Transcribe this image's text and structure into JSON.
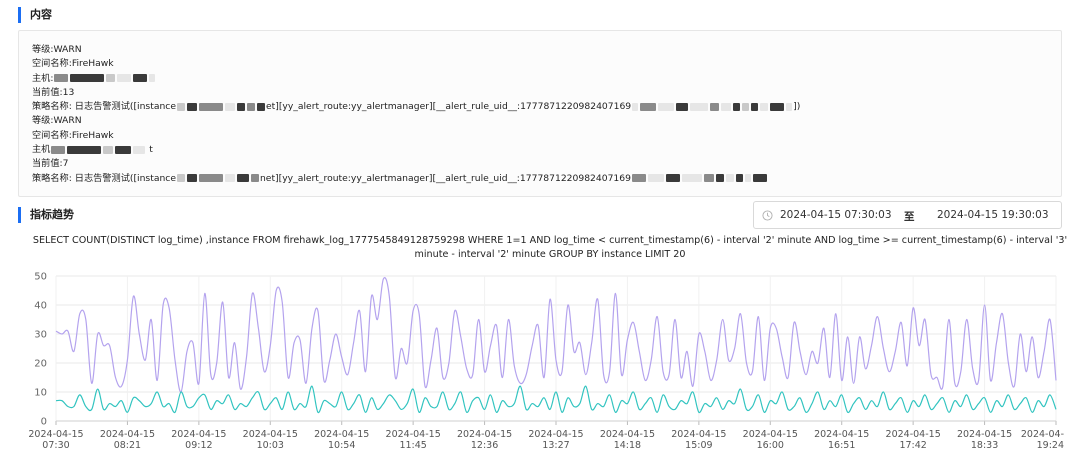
{
  "sections": {
    "content_title": "内容",
    "trend_title": "指标趋势"
  },
  "alerts": [
    {
      "level": "等级:WARN",
      "space": "空间名称:FireHawk",
      "host_prefix": "主机:",
      "value": "当前值:13",
      "policy_prefix": "策略名称: 日志告警测试([instance",
      "policy_mid": "et][yy_alert_route:yy_alertmanager][__alert_rule_uid__:1777871220982407169",
      "policy_end": "])"
    },
    {
      "level": "等级:WARN",
      "space": "空间名称:FireHawk",
      "host_prefix": "主机",
      "host_suffix": "t",
      "value": "当前值:7",
      "policy_prefix": "策略名称: 日志告警测试([instance",
      "policy_mid": "net][yy_alert_route:yy_alertmanager][__alert_rule_uid__:1777871220982407169"
    }
  ],
  "time_range": {
    "start": "2024-04-15 07:30:03",
    "separator": "至",
    "end": "2024-04-15 19:30:03"
  },
  "query": {
    "line1": "SELECT COUNT(DISTINCT log_time) ,instance FROM firehawk_log_1777545849128759298 WHERE 1=1 AND log_time < current_timestamp(6) - interval '2' minute AND log_time >= current_timestamp(6) - interval '3'",
    "line2": "minute - interval '2' minute GROUP BY instance LIMIT 20"
  },
  "icons": {
    "time_icon": "clock-icon"
  },
  "colors": {
    "accent": "#1b6ef3",
    "series_purple": "#b4a3ee",
    "series_teal": "#32c4c0",
    "grid": "#e8e8e8"
  },
  "chart_data": {
    "type": "line",
    "ylim": [
      0,
      50
    ],
    "yticks": [
      0,
      10,
      20,
      30,
      40,
      50
    ],
    "x_ticks": [
      [
        "2024-04-15",
        "07:30"
      ],
      [
        "2024-04-15",
        "08:21"
      ],
      [
        "2024-04-15",
        "09:12"
      ],
      [
        "2024-04-15",
        "10:03"
      ],
      [
        "2024-04-15",
        "10:54"
      ],
      [
        "2024-04-15",
        "11:45"
      ],
      [
        "2024-04-15",
        "12:36"
      ],
      [
        "2024-04-15",
        "13:27"
      ],
      [
        "2024-04-15",
        "14:18"
      ],
      [
        "2024-04-15",
        "15:09"
      ],
      [
        "2024-04-15",
        "16:00"
      ],
      [
        "2024-04-15",
        "16:51"
      ],
      [
        "2024-04-15",
        "17:42"
      ],
      [
        "2024-04-15",
        "18:33"
      ],
      [
        "2024-04-",
        "19:24"
      ]
    ],
    "series": [
      {
        "color": "#b4a3ee",
        "values": [
          31,
          30,
          31,
          24,
          37,
          35,
          13,
          30,
          26,
          26,
          15,
          12,
          21,
          43,
          30,
          21,
          35,
          14,
          40,
          39,
          21,
          10,
          24,
          27,
          13,
          44,
          16,
          20,
          41,
          15,
          27,
          11,
          22,
          44,
          32,
          17,
          26,
          45,
          41,
          15,
          27,
          28,
          13,
          32,
          38,
          14,
          21,
          30,
          22,
          16,
          27,
          38,
          17,
          43,
          35,
          49,
          43,
          15,
          25,
          20,
          38,
          37,
          12,
          21,
          32,
          15,
          20,
          38,
          29,
          18,
          16,
          35,
          17,
          26,
          33,
          15,
          35,
          19,
          13,
          16,
          26,
          33,
          15,
          42,
          21,
          17,
          40,
          24,
          27,
          16,
          27,
          42,
          16,
          17,
          44,
          16,
          28,
          34,
          24,
          14,
          21,
          36,
          17,
          16,
          35,
          15,
          24,
          12,
          30,
          24,
          14,
          21,
          35,
          21,
          25,
          37,
          20,
          17,
          36,
          14,
          32,
          32,
          22,
          15,
          34,
          24,
          16,
          24,
          20,
          32,
          15,
          37,
          14,
          29,
          13,
          29,
          18,
          26,
          36,
          25,
          17,
          24,
          34,
          19,
          39,
          26,
          35,
          16,
          15,
          12,
          35,
          13,
          17,
          35,
          18,
          14,
          40,
          14,
          27,
          37,
          20,
          12,
          30,
          17,
          29,
          15,
          24,
          35,
          14
        ]
      },
      {
        "color": "#32c4c0",
        "values": [
          7,
          7,
          5,
          5,
          9,
          5,
          4,
          11,
          4,
          6,
          5,
          7,
          3,
          8,
          7,
          5,
          6,
          10,
          5,
          6,
          3,
          10,
          5,
          5,
          8,
          9,
          4,
          7,
          6,
          9,
          4,
          6,
          5,
          8,
          10,
          4,
          6,
          8,
          4,
          10,
          4,
          6,
          5,
          12,
          3,
          7,
          6,
          5,
          10,
          4,
          6,
          9,
          3,
          8,
          4,
          6,
          9,
          7,
          4,
          6,
          11,
          3,
          8,
          5,
          5,
          10,
          4,
          6,
          10,
          3,
          7,
          8,
          4,
          9,
          3,
          7,
          5,
          6,
          12,
          4,
          6,
          5,
          8,
          4,
          10,
          3,
          8,
          5,
          6,
          12,
          4,
          6,
          5,
          9,
          3,
          7,
          6,
          10,
          4,
          6,
          8,
          3,
          9,
          5,
          4,
          7,
          6,
          10,
          3,
          6,
          5,
          8,
          4,
          7,
          6,
          11,
          4,
          5,
          9,
          3,
          7,
          6,
          10,
          4,
          5,
          8,
          3,
          6,
          10,
          4,
          7,
          5,
          9,
          3,
          6,
          8,
          4,
          7,
          5,
          10,
          4,
          6,
          8,
          3,
          7,
          5,
          9,
          4,
          6,
          8,
          3,
          7,
          5,
          9,
          4,
          6,
          8,
          3,
          7,
          5,
          9,
          4,
          6,
          8,
          3,
          7,
          5,
          9,
          4
        ]
      }
    ]
  }
}
